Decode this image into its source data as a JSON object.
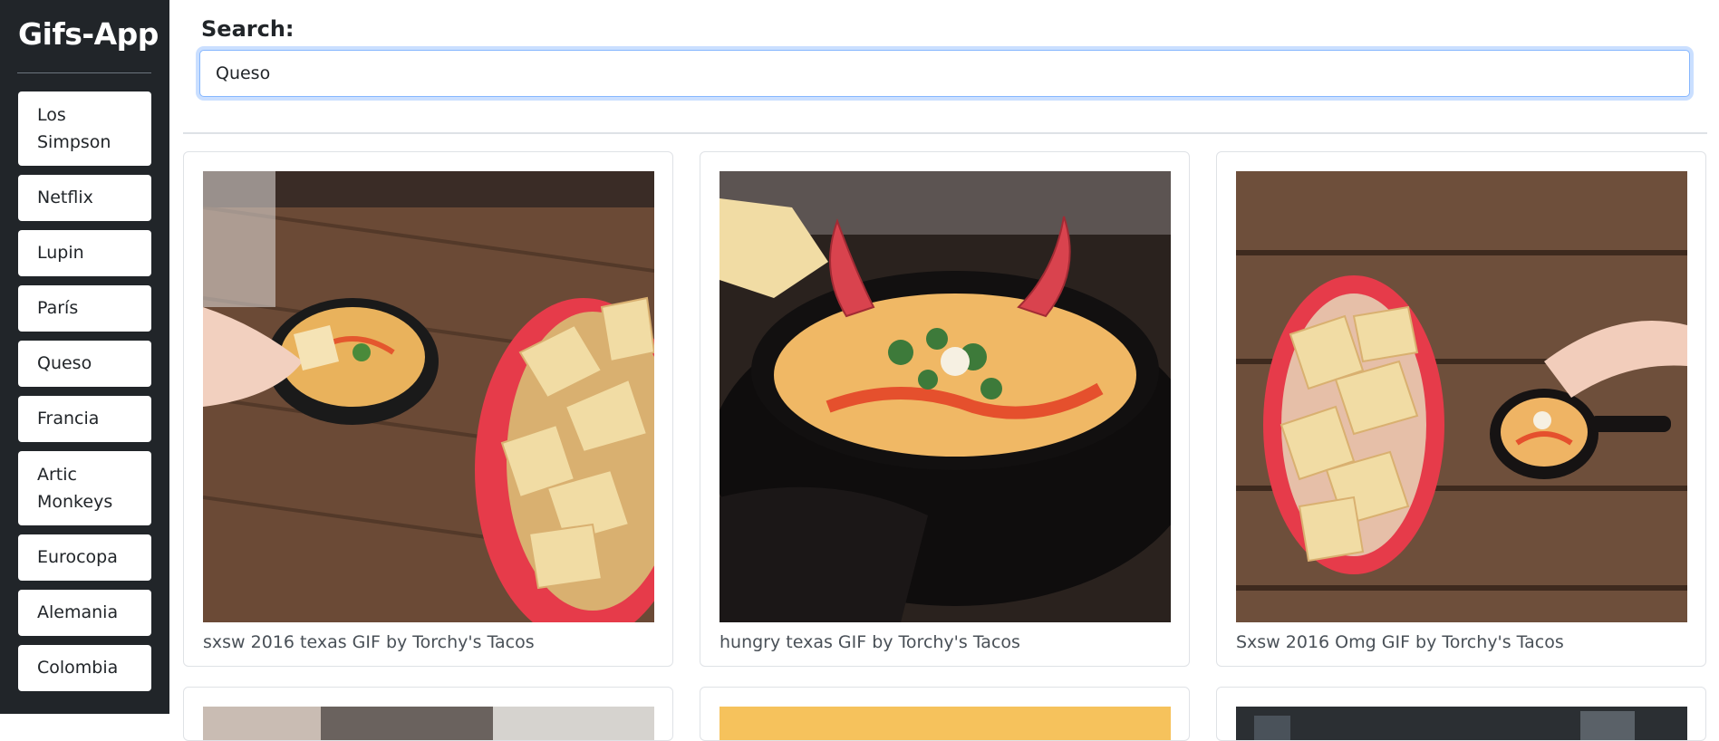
{
  "app": {
    "title": "Gifs-App"
  },
  "sidebar": {
    "items": [
      {
        "label": "Los Simpson"
      },
      {
        "label": "Netflix"
      },
      {
        "label": "Lupin"
      },
      {
        "label": "París"
      },
      {
        "label": "Queso"
      },
      {
        "label": "Francia"
      },
      {
        "label": "Artic Monkeys"
      },
      {
        "label": "Eurocopa"
      },
      {
        "label": "Alemania"
      },
      {
        "label": "Colombia"
      }
    ]
  },
  "search": {
    "label": "Search:",
    "value": "Queso"
  },
  "results": [
    {
      "caption": "sxsw 2016 texas GIF by Torchy's Tacos"
    },
    {
      "caption": "hungry texas GIF by Torchy's Tacos"
    },
    {
      "caption": "Sxsw 2016 Omg GIF by Torchy's Tacos"
    }
  ],
  "colors": {
    "sidebar_bg": "#212529",
    "input_focus": "#86b7fe",
    "placeholder_tile": "#f6c25c"
  }
}
